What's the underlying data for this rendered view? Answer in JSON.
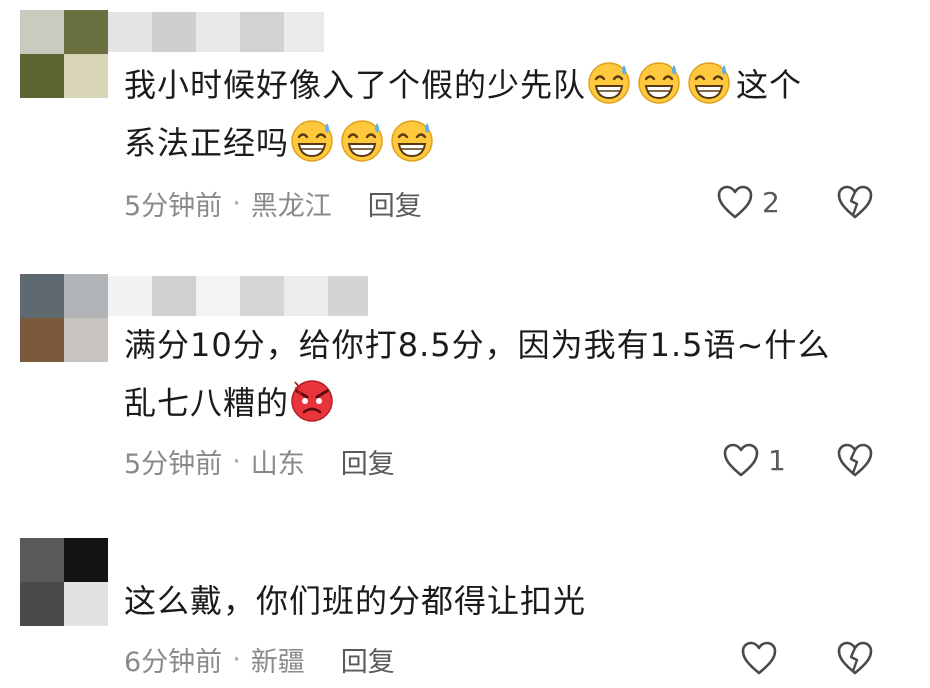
{
  "comments": [
    {
      "text_line1": "我小时候好像入了个假的少先队",
      "text_line1_after": "这个",
      "text_line2": "系法正经吗",
      "time": "5分钟前",
      "separator": "·",
      "location": "黑龙江",
      "reply_label": "回复",
      "likes": "2",
      "emoji": "grinning-sweat-emoji"
    },
    {
      "text_line1": "满分10分，给你打8.5分，因为我有1.5语~什么",
      "text_line2": "乱七八糟的",
      "time": "5分钟前",
      "separator": "·",
      "location": "山东",
      "reply_label": "回复",
      "likes": "1",
      "emoji": "angry-face-emoji"
    },
    {
      "text_line1": "这么戴，你们班的分都得让扣光",
      "time": "6分钟前",
      "separator": "·",
      "location": "新疆",
      "reply_label": "回复",
      "likes": ""
    }
  ],
  "colors": {
    "text": "#1b1b1b",
    "meta": "#8a8a8a",
    "emoji_face": "#ffc83d",
    "angry_face": "#e8353b"
  }
}
